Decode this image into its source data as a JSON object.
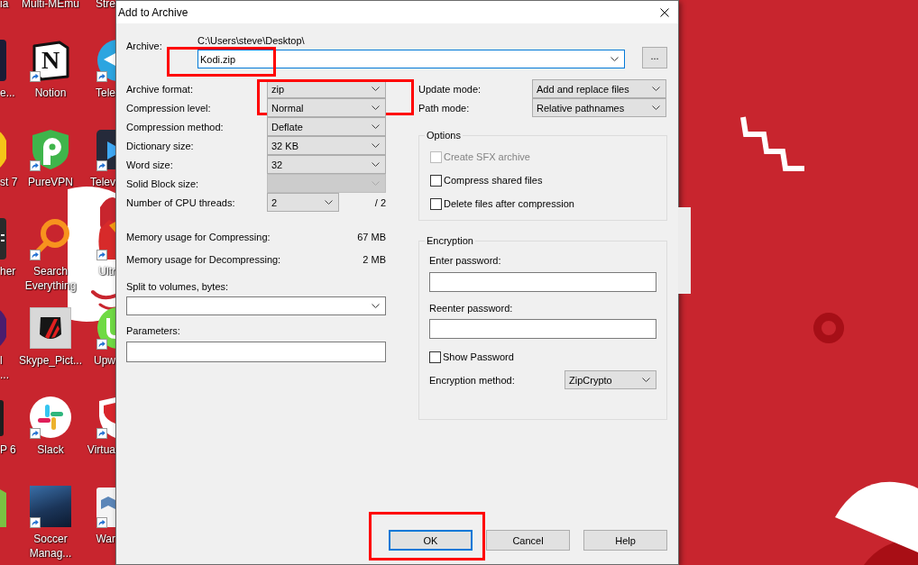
{
  "desktop": {
    "icon_columns": [
      {
        "icons": [
          {
            "label": "ia"
          },
          {
            "label": "e...",
            "shortcut": false
          },
          {
            "label": "st 7",
            "shortcut": false
          },
          {
            "label": "her",
            "shortcut": false
          },
          {
            "label": "l\n...",
            "shortcut": false
          },
          {
            "label": "P 6",
            "shortcut": false
          },
          {
            "shortcut": false
          }
        ]
      },
      {
        "icons": [
          {
            "label": "Multi-MEmu"
          },
          {
            "label": "Notion",
            "shortcut": true,
            "logo_text": "N"
          },
          {
            "label": "PureVPN",
            "shortcut": true
          },
          {
            "label": "Search Everything",
            "shortcut": true
          },
          {
            "label": "Skype_Pict...",
            "shortcut": false
          },
          {
            "label": "Slack",
            "shortcut": true
          },
          {
            "label": "Soccer Manag...",
            "shortcut": true
          }
        ]
      },
      {
        "icons": [
          {
            "label": "Stre"
          },
          {
            "label": "Tele",
            "shortcut": true
          },
          {
            "label": "Telev",
            "shortcut": true
          },
          {
            "label": "Ultr",
            "shortcut": true
          },
          {
            "label": "Upw",
            "shortcut": true
          },
          {
            "label": "Virtua",
            "shortcut": true
          },
          {
            "label": "War",
            "shortcut": true
          }
        ]
      }
    ]
  },
  "dialog": {
    "title": "Add to Archive",
    "archive": {
      "label": "Archive:",
      "path": "C:\\Users\\steve\\Desktop\\",
      "value": "Kodi.zip",
      "focused": true,
      "highlighted": true,
      "browse_button": "..."
    },
    "settings": [
      {
        "kind": "dropdown",
        "label": "Archive format:",
        "value": "zip",
        "disabled": false,
        "highlighted": true
      },
      {
        "kind": "dropdown",
        "label": "Compression level:",
        "value": "Normal",
        "disabled": false,
        "highlighted": false
      },
      {
        "kind": "dropdown",
        "label": "Compression method:",
        "value": "Deflate",
        "disabled": false,
        "highlighted": false
      },
      {
        "kind": "dropdown",
        "label": "Dictionary size:",
        "value": "32 KB",
        "disabled": false,
        "highlighted": false
      },
      {
        "kind": "dropdown",
        "label": "Word size:",
        "value": "32",
        "disabled": false,
        "highlighted": false
      },
      {
        "kind": "dropdown",
        "label": "Solid Block size:",
        "disabled": true,
        "highlighted": false
      },
      {
        "kind": "threads",
        "label": "Number of CPU threads:",
        "value": "2",
        "max": "/ 2",
        "disabled": false,
        "highlighted": false
      }
    ],
    "memory": [
      {
        "label": "Memory usage for Compressing:",
        "value": "67 MB"
      },
      {
        "label": "Memory usage for Decompressing:",
        "value": "2 MB"
      }
    ],
    "split": {
      "label": "Split to volumes, bytes:"
    },
    "parameters": {
      "label": "Parameters:"
    },
    "modes": [
      {
        "label": "Update mode:",
        "value": "Add and replace files"
      },
      {
        "label": "Path mode:",
        "value": "Relative pathnames"
      }
    ],
    "options": {
      "title": "Options",
      "checkboxes": [
        {
          "label": "Create SFX archive",
          "checked": false,
          "disabled": true
        },
        {
          "label": "Compress shared files",
          "checked": false,
          "disabled": false
        },
        {
          "label": "Delete files after compression",
          "checked": false,
          "disabled": false
        }
      ]
    },
    "encryption": {
      "title": "Encryption",
      "password_label": "Enter password:",
      "reenter_label": "Reenter password:",
      "show_password": {
        "label": "Show Password",
        "checked": false
      },
      "method": {
        "label": "Encryption method:",
        "value": "ZipCrypto"
      }
    },
    "buttons": [
      {
        "label": "OK",
        "default": true,
        "highlighted": true
      },
      {
        "label": "Cancel",
        "default": false,
        "highlighted": false
      },
      {
        "label": "Help",
        "default": false,
        "highlighted": false
      }
    ]
  }
}
